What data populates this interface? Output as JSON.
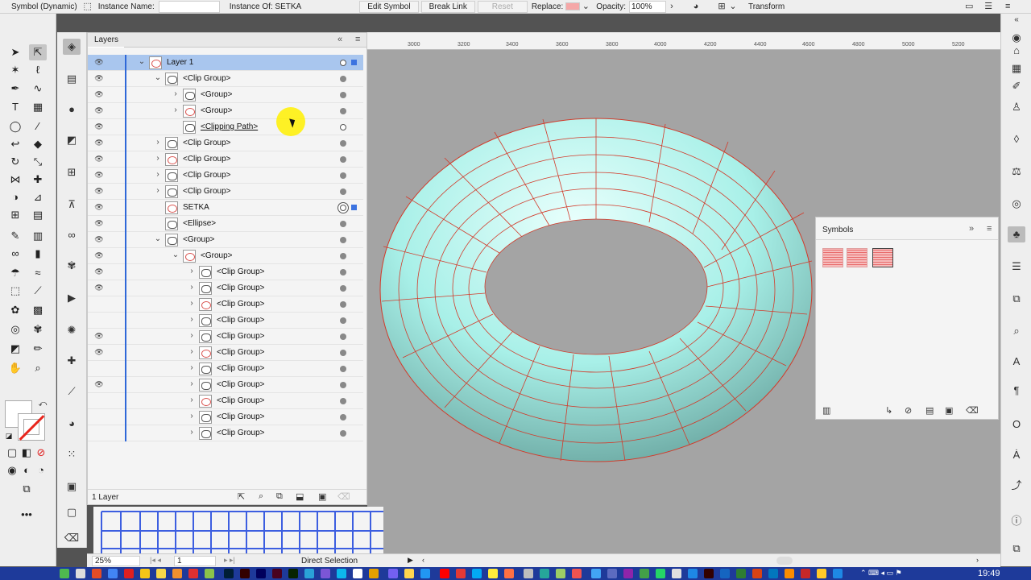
{
  "control_bar": {
    "mode": "Symbol (Dynamic)",
    "instance_name_label": "Instance Name:",
    "instance_name_value": "",
    "instance_of_label": "Instance Of: SETKA",
    "edit_symbol": "Edit Symbol",
    "break_link": "Break Link",
    "reset": "Reset",
    "replace_label": "Replace:",
    "opacity_label": "Opacity:",
    "opacity_value": "100%",
    "transform": "Transform"
  },
  "layers_panel": {
    "tab": "Layers",
    "footer_count": "1 Layer",
    "rows": [
      {
        "label": "Layer 1",
        "depth": 0,
        "expanded": true,
        "visible": true,
        "selected": true
      },
      {
        "label": "<Clip Group>",
        "depth": 1,
        "expanded": true,
        "visible": true
      },
      {
        "label": "<Group>",
        "depth": 2,
        "expanded": false,
        "visible": true
      },
      {
        "label": "<Group>",
        "depth": 2,
        "expanded": false,
        "visible": true
      },
      {
        "label": "<Clipping Path>",
        "depth": 2,
        "visible": true,
        "underline": true
      },
      {
        "label": "<Clip Group>",
        "depth": 1,
        "expanded": false,
        "visible": true
      },
      {
        "label": "<Clip Group>",
        "depth": 1,
        "expanded": false,
        "visible": true
      },
      {
        "label": "<Clip Group>",
        "depth": 1,
        "expanded": false,
        "visible": true
      },
      {
        "label": "<Clip Group>",
        "depth": 1,
        "expanded": false,
        "visible": true
      },
      {
        "label": "SETKA",
        "depth": 1,
        "visible": true
      },
      {
        "label": "<Ellipse>",
        "depth": 1,
        "visible": true
      },
      {
        "label": "<Group>",
        "depth": 1,
        "expanded": true,
        "visible": true
      },
      {
        "label": "<Group>",
        "depth": 2,
        "expanded": true,
        "visible": true
      },
      {
        "label": "<Clip Group>",
        "depth": 3,
        "expanded": false,
        "visible": true
      },
      {
        "label": "<Clip Group>",
        "depth": 3,
        "expanded": false,
        "visible": true
      },
      {
        "label": "<Clip Group>",
        "depth": 3,
        "expanded": false,
        "visible": false
      },
      {
        "label": "<Clip Group>",
        "depth": 3,
        "expanded": false,
        "visible": false
      },
      {
        "label": "<Clip Group>",
        "depth": 3,
        "expanded": false,
        "visible": true
      },
      {
        "label": "<Clip Group>",
        "depth": 3,
        "expanded": false,
        "visible": true
      },
      {
        "label": "<Clip Group>",
        "depth": 3,
        "expanded": false,
        "visible": false
      },
      {
        "label": "<Clip Group>",
        "depth": 3,
        "expanded": false,
        "visible": true
      },
      {
        "label": "<Clip Group>",
        "depth": 3,
        "expanded": false,
        "visible": false
      },
      {
        "label": "<Clip Group>",
        "depth": 3,
        "expanded": false,
        "visible": false
      },
      {
        "label": "<Clip Group>",
        "depth": 3,
        "expanded": false,
        "visible": false
      }
    ]
  },
  "ruler": {
    "ticks": [
      "3000",
      "3200",
      "3400",
      "3600",
      "3800",
      "4000",
      "4200",
      "4400",
      "4600",
      "4800",
      "5000",
      "5200"
    ]
  },
  "symbols_panel": {
    "tab": "Symbols"
  },
  "status_bar": {
    "zoom": "25%",
    "page": "1",
    "tool": "Direct Selection"
  },
  "taskbar": {
    "clock": "19:49"
  },
  "colors": {
    "torus": "#a8f0e8",
    "grid_lines": "#d23a2a",
    "canvas": "#a4a4a4",
    "selection_blue": "#3c73e0"
  }
}
